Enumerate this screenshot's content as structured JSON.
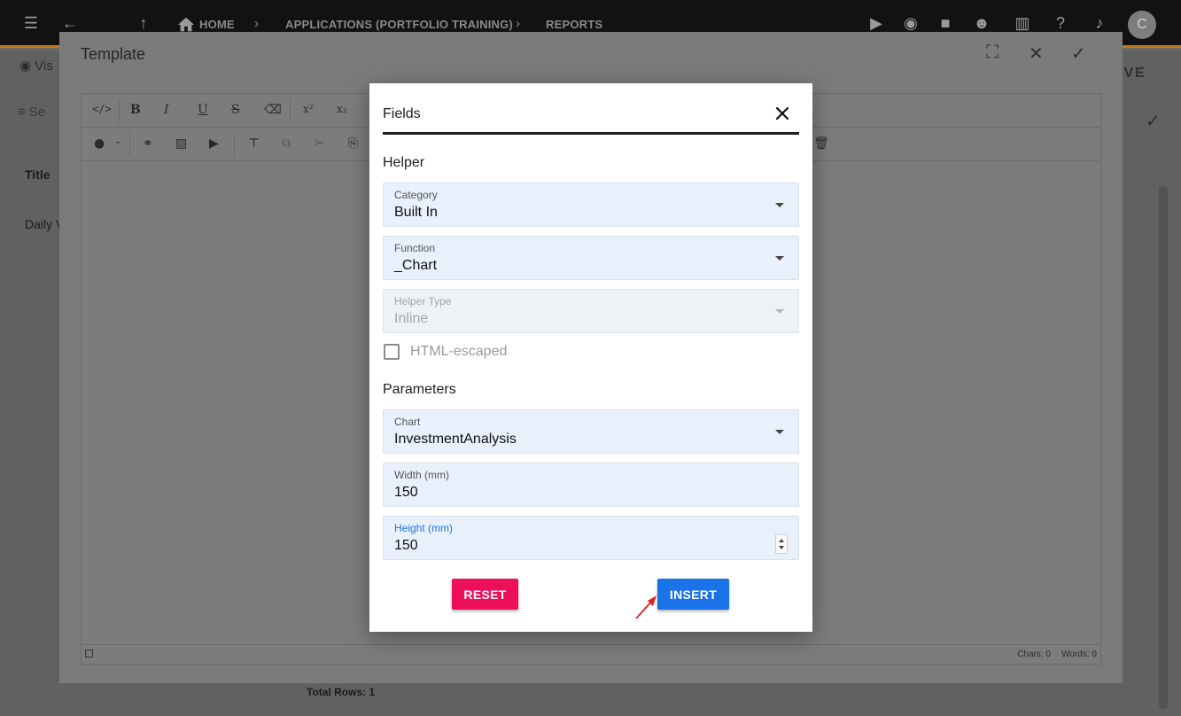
{
  "app": {
    "breadcrumbs": [
      "HOME",
      "APPLICATIONS (PORTFOLIO TRAINING)",
      "REPORTS"
    ],
    "avatar_initial": "C",
    "background_view_label": "Vis",
    "background_logo_text": "IVE",
    "background_search_label": "Se",
    "background_column_title": "Title",
    "background_row_text": "Daily V",
    "background_total_rows": "Total Rows: 1"
  },
  "template_dialog": {
    "title": "Template",
    "status": {
      "chars": "Chars: 0",
      "words": "Words: 0"
    }
  },
  "fields_modal": {
    "title": "Fields",
    "helper_section": "Helper",
    "category": {
      "label": "Category",
      "value": "Built In"
    },
    "function": {
      "label": "Function",
      "value": "_Chart"
    },
    "helper_type": {
      "label": "Helper Type",
      "value": "Inline"
    },
    "html_escaped": {
      "label": "HTML-escaped",
      "checked": false
    },
    "parameters_section": "Parameters",
    "chart": {
      "label": "Chart",
      "value": "InvestmentAnalysis"
    },
    "width": {
      "label": "Width (mm)",
      "value": "150"
    },
    "height": {
      "label": "Height (mm)",
      "value": "150"
    },
    "reset_label": "RESET",
    "insert_label": "INSERT"
  },
  "colors": {
    "reset_button": "#ee0f5b",
    "insert_button": "#1a73e8",
    "field_background": "#e8f1fb",
    "annotation_arrow": "#e02020"
  }
}
